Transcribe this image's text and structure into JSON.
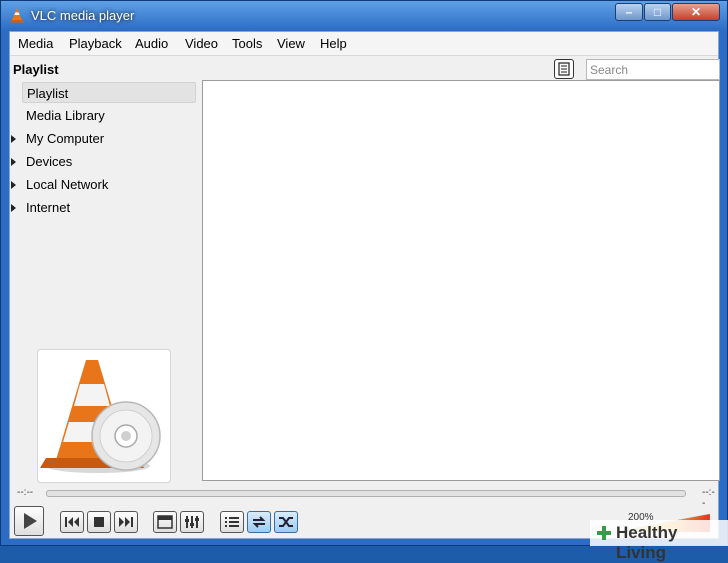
{
  "window": {
    "title": "VLC media player"
  },
  "menu": [
    "Media",
    "Playback",
    "Audio",
    "Video",
    "Tools",
    "View",
    "Help"
  ],
  "playlist": {
    "heading": "Playlist",
    "search_placeholder": "Search",
    "sidebar": [
      {
        "label": "Playlist",
        "selected": true,
        "expandable": false
      },
      {
        "label": "Media Library",
        "selected": false,
        "expandable": false
      },
      {
        "label": "My Computer",
        "selected": false,
        "expandable": true
      },
      {
        "label": "Devices",
        "selected": false,
        "expandable": true
      },
      {
        "label": "Local Network",
        "selected": false,
        "expandable": true
      },
      {
        "label": "Internet",
        "selected": false,
        "expandable": true
      }
    ]
  },
  "seek": {
    "elapsed": "--:--",
    "remaining": "--:--"
  },
  "volume": {
    "label": "200%"
  },
  "watermark": {
    "text": "Healthy Living"
  },
  "colors": {
    "cone_orange": "#e8751a",
    "accent_blue": "#2b6cc4",
    "volume_red": "#e8301a"
  }
}
